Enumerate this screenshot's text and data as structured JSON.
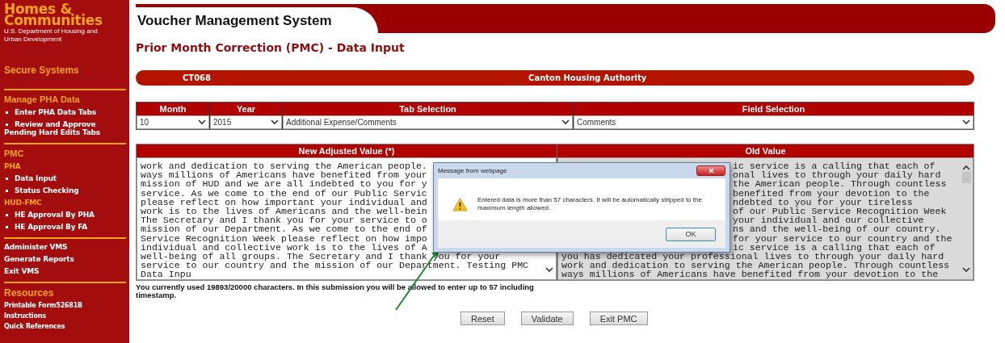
{
  "sidebar": {
    "logo_lines": [
      "Homes &",
      "Communities"
    ],
    "agency": "U.S. Department of Housing and Urban Development",
    "sections": [
      {
        "title": "Secure Systems"
      },
      {
        "title": "Manage PHA Data",
        "items": [
          {
            "kind": "bullet",
            "label": "Enter PHA Data Tabs"
          },
          {
            "kind": "bullet",
            "label": "Review and Approve Pending Hard Edits Tabs"
          }
        ]
      },
      {
        "title": "PMC",
        "items": [
          {
            "kind": "subheading",
            "label": "PHA"
          },
          {
            "kind": "bullet",
            "label": "Data Input"
          },
          {
            "kind": "bullet",
            "label": "Status Checking"
          },
          {
            "kind": "subheading",
            "label": "HUD-FMC"
          },
          {
            "kind": "bullet",
            "label": "HE Approval By PHA"
          },
          {
            "kind": "bullet",
            "label": "HE Approval By FA"
          }
        ]
      },
      {
        "items": [
          {
            "kind": "link",
            "label": "Administer VMS"
          },
          {
            "kind": "link",
            "label": "Generate Reports"
          },
          {
            "kind": "link",
            "label": "Exit VMS"
          }
        ]
      },
      {
        "title": "Resources",
        "items": [
          {
            "kind": "small",
            "label": "Printable Form52681B"
          },
          {
            "kind": "small",
            "label": "Instructions"
          },
          {
            "kind": "small",
            "label": "Quick References"
          }
        ]
      }
    ]
  },
  "header": {
    "title": "Voucher Management System"
  },
  "page_title": "Prior Month Correction (PMC) - Data Input",
  "pha_bar": {
    "code": "CT068",
    "name": "Canton Housing Authority"
  },
  "selectors": [
    {
      "heading": "Month",
      "value": "10"
    },
    {
      "heading": "Year",
      "value": "2015"
    },
    {
      "heading": "Tab Selection",
      "value": "Additional Expense/Comments"
    },
    {
      "heading": "Field Selection",
      "value": "Comments"
    }
  ],
  "new_value": {
    "heading": "New Adjusted Value (*)",
    "readonly": false,
    "lines": [
      {
        "text": "work and dedication to serving the American people.",
        "covered": false
      },
      {
        "text": "ways millions of Americans have benefited from your",
        "covered": false
      },
      {
        "text": "mission of HUD and we are all indebted to you for y",
        "covered": false
      },
      {
        "text": "service. As we come to the end of our Public Servic",
        "covered": false
      },
      {
        "text": "please reflect on how important your individual and",
        "covered": false
      },
      {
        "text": "work is to the lives of Americans and the well-bein",
        "covered": false
      },
      {
        "text": "The Secretary and I thank you for your service to o",
        "covered": false
      },
      {
        "text": "mission of our Department. As we come to the end of",
        "covered": false
      },
      {
        "text": "Service Recognition Week please reflect on how impo",
        "covered": false
      },
      {
        "text": "individual and collective work is to the lives of A",
        "covered": false
      },
      {
        "text": "well-being of all groups. The Secretary and I thank you for your",
        "covered": false
      },
      {
        "text": "service to our country and the mission of our Department. Testing PMC",
        "covered": false
      },
      {
        "text": "Data Inpu",
        "covered": false
      }
    ]
  },
  "old_value": {
    "heading": "Old Value",
    "readonly": true,
    "lines": [
      {
        "text": "ic service is a calling that each of",
        "covered": true
      },
      {
        "text": "onal lives to through your daily hard",
        "covered": true
      },
      {
        "text": "the American people. Through countless",
        "covered": true
      },
      {
        "text": "benefited from your devotion to the",
        "covered": true
      },
      {
        "text": "ndebted to you for your tireless",
        "covered": true
      },
      {
        "text": "of our Public Service Recognition Week",
        "covered": true
      },
      {
        "text": "your individual and our collective",
        "covered": true
      },
      {
        "text": "ns and the well-being of our country.",
        "covered": true
      },
      {
        "text": "for your service to our country and the",
        "covered": true
      },
      {
        "text": "ic service is a calling that each of",
        "covered": true
      },
      {
        "text": "you has dedicated your professional lives to through your daily hard",
        "covered": false
      },
      {
        "text": "work and dedication to serving the American people. Through countless",
        "covered": false
      },
      {
        "text": "ways millions of Americans have benefited from your devotion to the",
        "covered": false
      }
    ]
  },
  "notice": "You currently used 19893/20000 characters. In this submission you will be allowed to enter up to 57 including timestamp.",
  "buttons": [
    "Reset",
    "Validate",
    "Exit PMC"
  ],
  "dialog": {
    "title": "Message from webpage",
    "message": "Entered data is more than 57 characters. It will be automatically stripped to the maximum length allowed.",
    "button": "OK"
  }
}
